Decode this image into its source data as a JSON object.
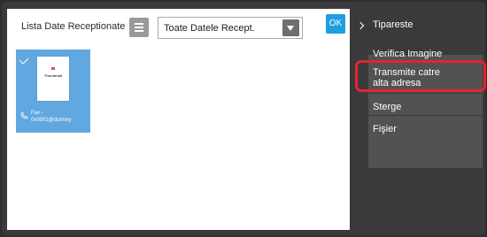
{
  "toolbar": {
    "list_title": "Lista Date Receptionate",
    "filter_value": "Toate Datele Recept.",
    "ok_label": "OK"
  },
  "document": {
    "preview_label": "Thumbnail",
    "fax_line1": "Fax -",
    "fax_line2": "0x0001@dummy"
  },
  "menu": {
    "items": [
      {
        "label": "Tipareste"
      },
      {
        "label": "Verifica Imagine"
      },
      {
        "label_line1": "Transmite catre",
        "label_line2": "alta adresa"
      },
      {
        "label": "Sterge"
      },
      {
        "label": "Fişier"
      }
    ]
  },
  "colors": {
    "accent_blue": "#1e9ee2",
    "thumbnail_selected": "#61a7e0",
    "highlight_red": "#e4232f"
  }
}
